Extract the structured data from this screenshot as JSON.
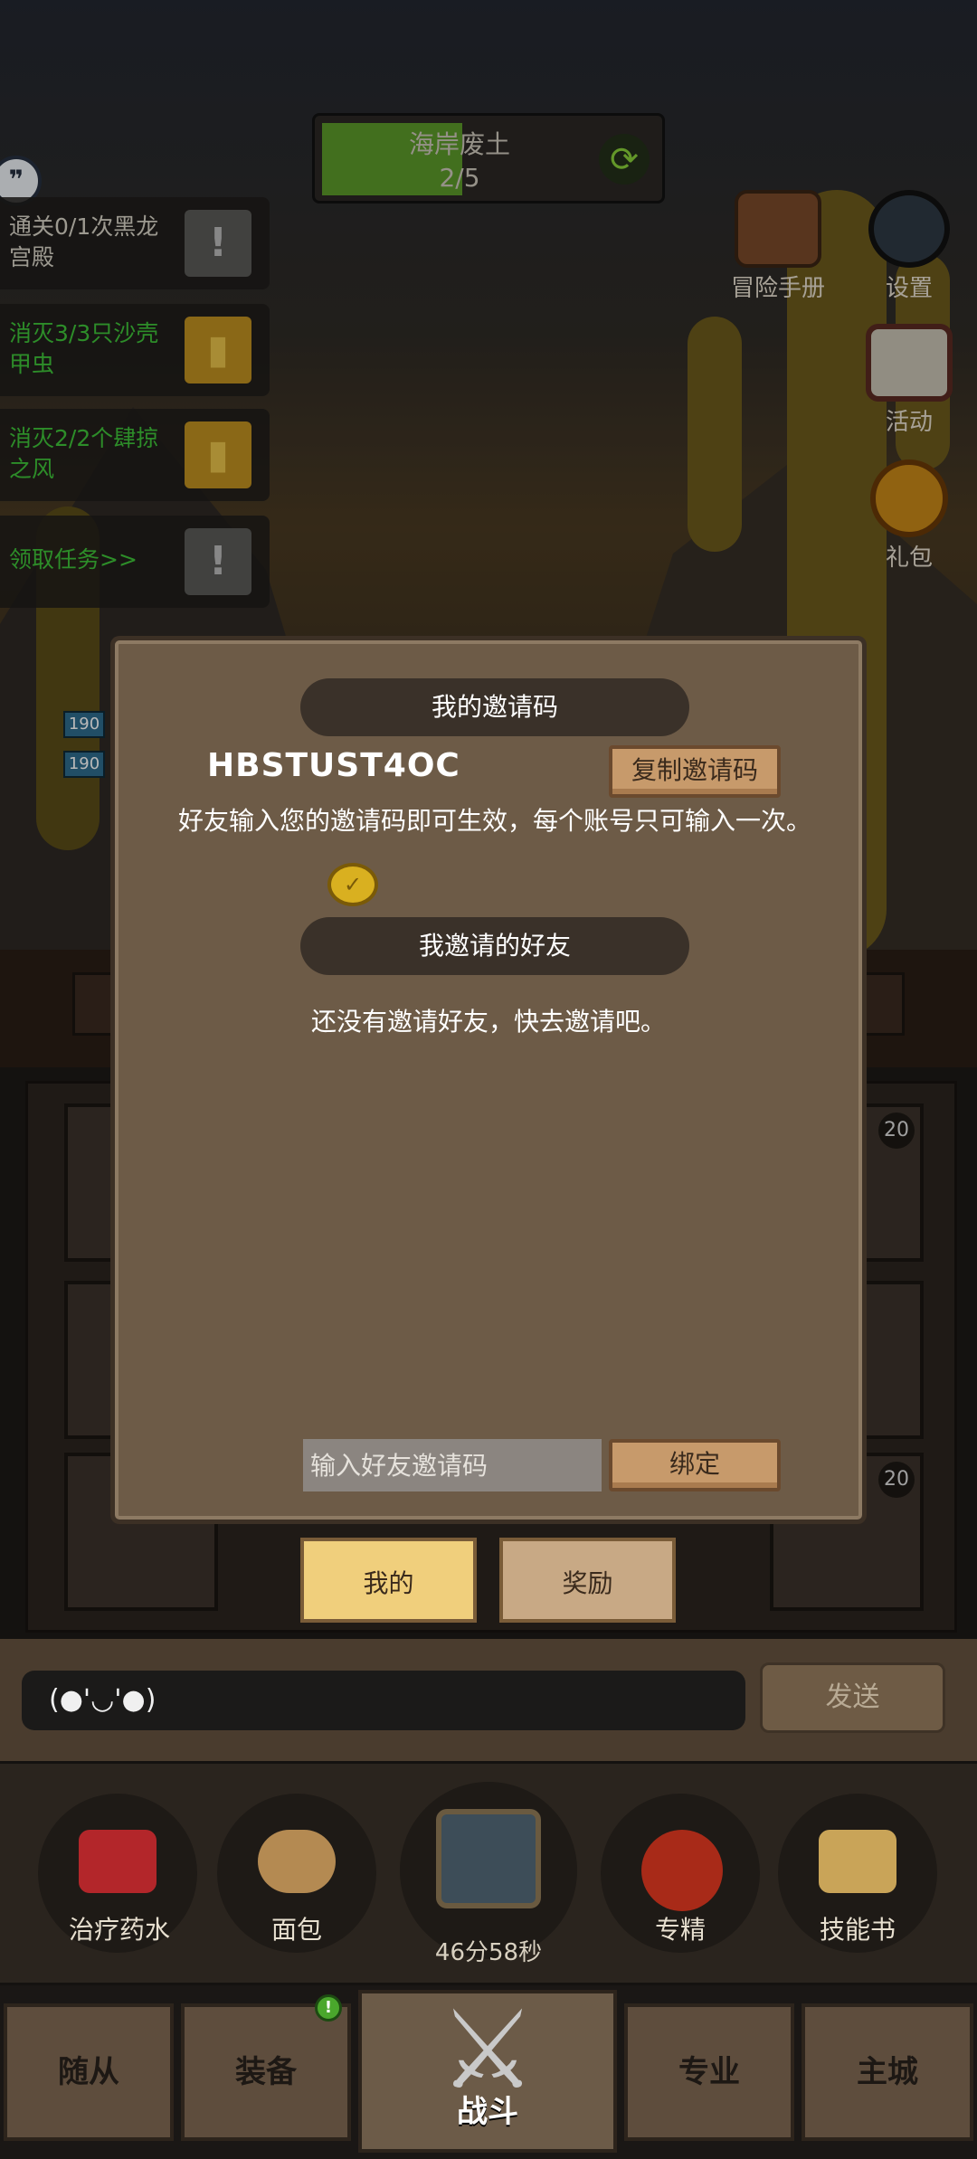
{
  "stage": {
    "name": "海岸废土",
    "progress": "2/5"
  },
  "quests": [
    {
      "text": "通关0/1次黑龙宫殿",
      "color": "#d9d4c8",
      "icon": "exclamation-icon",
      "state": "gray"
    },
    {
      "text": "消灭3/3只沙壳甲虫",
      "color": "#3fc43a",
      "icon": "trophy-icon",
      "state": "gold"
    },
    {
      "text": "消灭2/2个肆掠之风",
      "color": "#3fc43a",
      "icon": "trophy-icon",
      "state": "gold"
    },
    {
      "text": "领取任务>>",
      "color": "#3fc43a",
      "icon": "exclamation-icon",
      "state": "gray"
    }
  ],
  "side_menu": [
    {
      "label": "冒险手册",
      "icon": "book-icon"
    },
    {
      "label": "设置",
      "icon": "gear-icon"
    },
    {
      "label": "活动",
      "icon": "scroll-icon"
    },
    {
      "label": "礼包",
      "icon": "gift-coin-icon"
    }
  ],
  "hp_tags": [
    "190",
    "190"
  ],
  "slot_levels": [
    "20",
    "20"
  ],
  "modal": {
    "my_code_title": "我的邀请码",
    "invite_code": "HBSTUST4OC",
    "copy_button": "复制邀请码",
    "description": "好友输入您的邀请码即可生效，每个账号只可输入一次。",
    "friends_title": "我邀请的好友",
    "empty_text": "还没有邀请好友，快去邀请吧。",
    "input_placeholder": "输入好友邀请码",
    "bind_button": "绑定"
  },
  "tabs": [
    {
      "label": "我的",
      "active": true
    },
    {
      "label": "奖励",
      "active": false
    }
  ],
  "chat": {
    "input_text": "(●'◡'●)",
    "send_label": "发送"
  },
  "consumables": [
    {
      "label": "治疗药水",
      "icon": "potion-icon"
    },
    {
      "label": "面包",
      "icon": "bread-icon"
    },
    {
      "label": "",
      "icon": "chest-icon"
    },
    {
      "label": "专精",
      "icon": "mastery-icon"
    },
    {
      "label": "技能书",
      "icon": "skillbook-icon"
    }
  ],
  "chest_timer": "46分58秒",
  "bottom_nav": [
    {
      "label": "随从"
    },
    {
      "label": "装备",
      "badge": "!"
    },
    {
      "label": "战斗"
    },
    {
      "label": "专业"
    },
    {
      "label": "主城"
    }
  ],
  "colors": {
    "modal_bg": "#6d5b47",
    "accent_gold": "#f0cf7c",
    "quest_green": "#3fc43a"
  }
}
